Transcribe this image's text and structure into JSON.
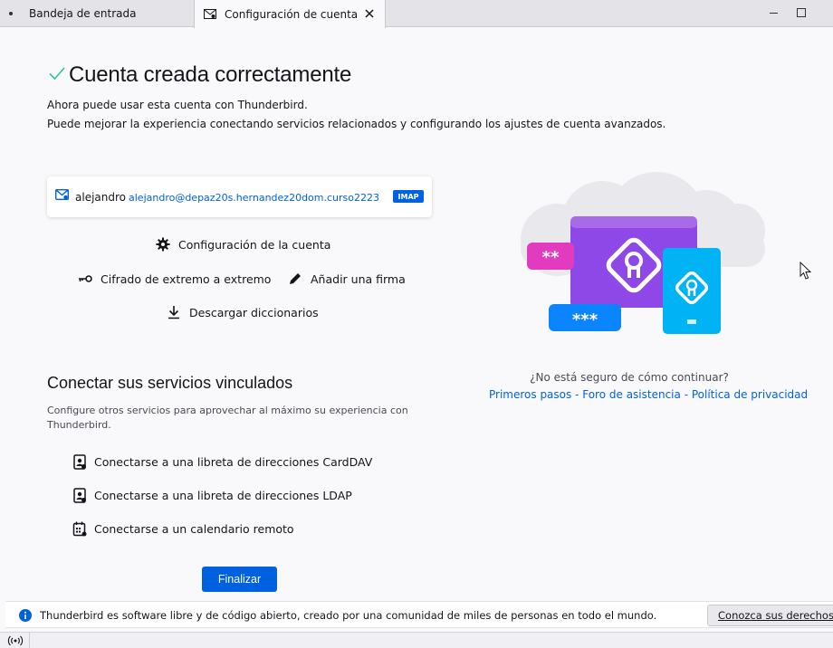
{
  "tabs": [
    {
      "label": "Bandeja de entrada",
      "icon": "inbox-dot-icon",
      "active": false
    },
    {
      "label": "Configuración de cuenta",
      "icon": "account-settings-icon",
      "active": true
    }
  ],
  "header": {
    "title": "Cuenta creada correctamente",
    "line1": "Ahora puede usar esta cuenta con Thunderbird.",
    "line2": "Puede mejorar la experiencia conectando servicios relacionados y configurando los ajustes de cuenta avanzados."
  },
  "account": {
    "name": "alejandro",
    "email": "alejandro@depaz20s.hernandez20dom.curso2223",
    "protocol": "IMAP"
  },
  "actions": {
    "config": "Configuración de la cuenta",
    "e2e": "Cifrado de extremo a extremo",
    "signature": "Añadir una firma",
    "dictionaries": "Descargar diccionarios"
  },
  "services": {
    "title": "Conectar sus servicios vinculados",
    "description": "Configure otros servicios para aprovechar al máximo su experiencia con Thunderbird.",
    "items": [
      {
        "label": "Conectarse a una libreta de direcciones CardDAV",
        "icon": "address-book-carddav-icon"
      },
      {
        "label": "Conectarse a una libreta de direcciones LDAP",
        "icon": "address-book-ldap-icon"
      },
      {
        "label": "Conectarse a un calendario remoto",
        "icon": "calendar-icon"
      }
    ]
  },
  "finish_label": "Finalizar",
  "help": {
    "question": "¿No está seguro de cómo continuar?",
    "link1": "Primeros pasos",
    "link2": "Foro de asistencia",
    "link3": "Política de privacidad",
    "separator": " - "
  },
  "illustration": {
    "password_mask_short": "**",
    "password_mask_long": "***"
  },
  "notification": {
    "text": "Thunderbird es software libre y de código abierto, creado por una comunidad de miles de personas en todo el mundo.",
    "button": "Conozca sus derechos..."
  },
  "colors": {
    "accent": "#0061e0",
    "success": "#2ac3a2",
    "purple": "#8f48e8",
    "pink": "#e13cbf",
    "cyan": "#00b3f4"
  }
}
